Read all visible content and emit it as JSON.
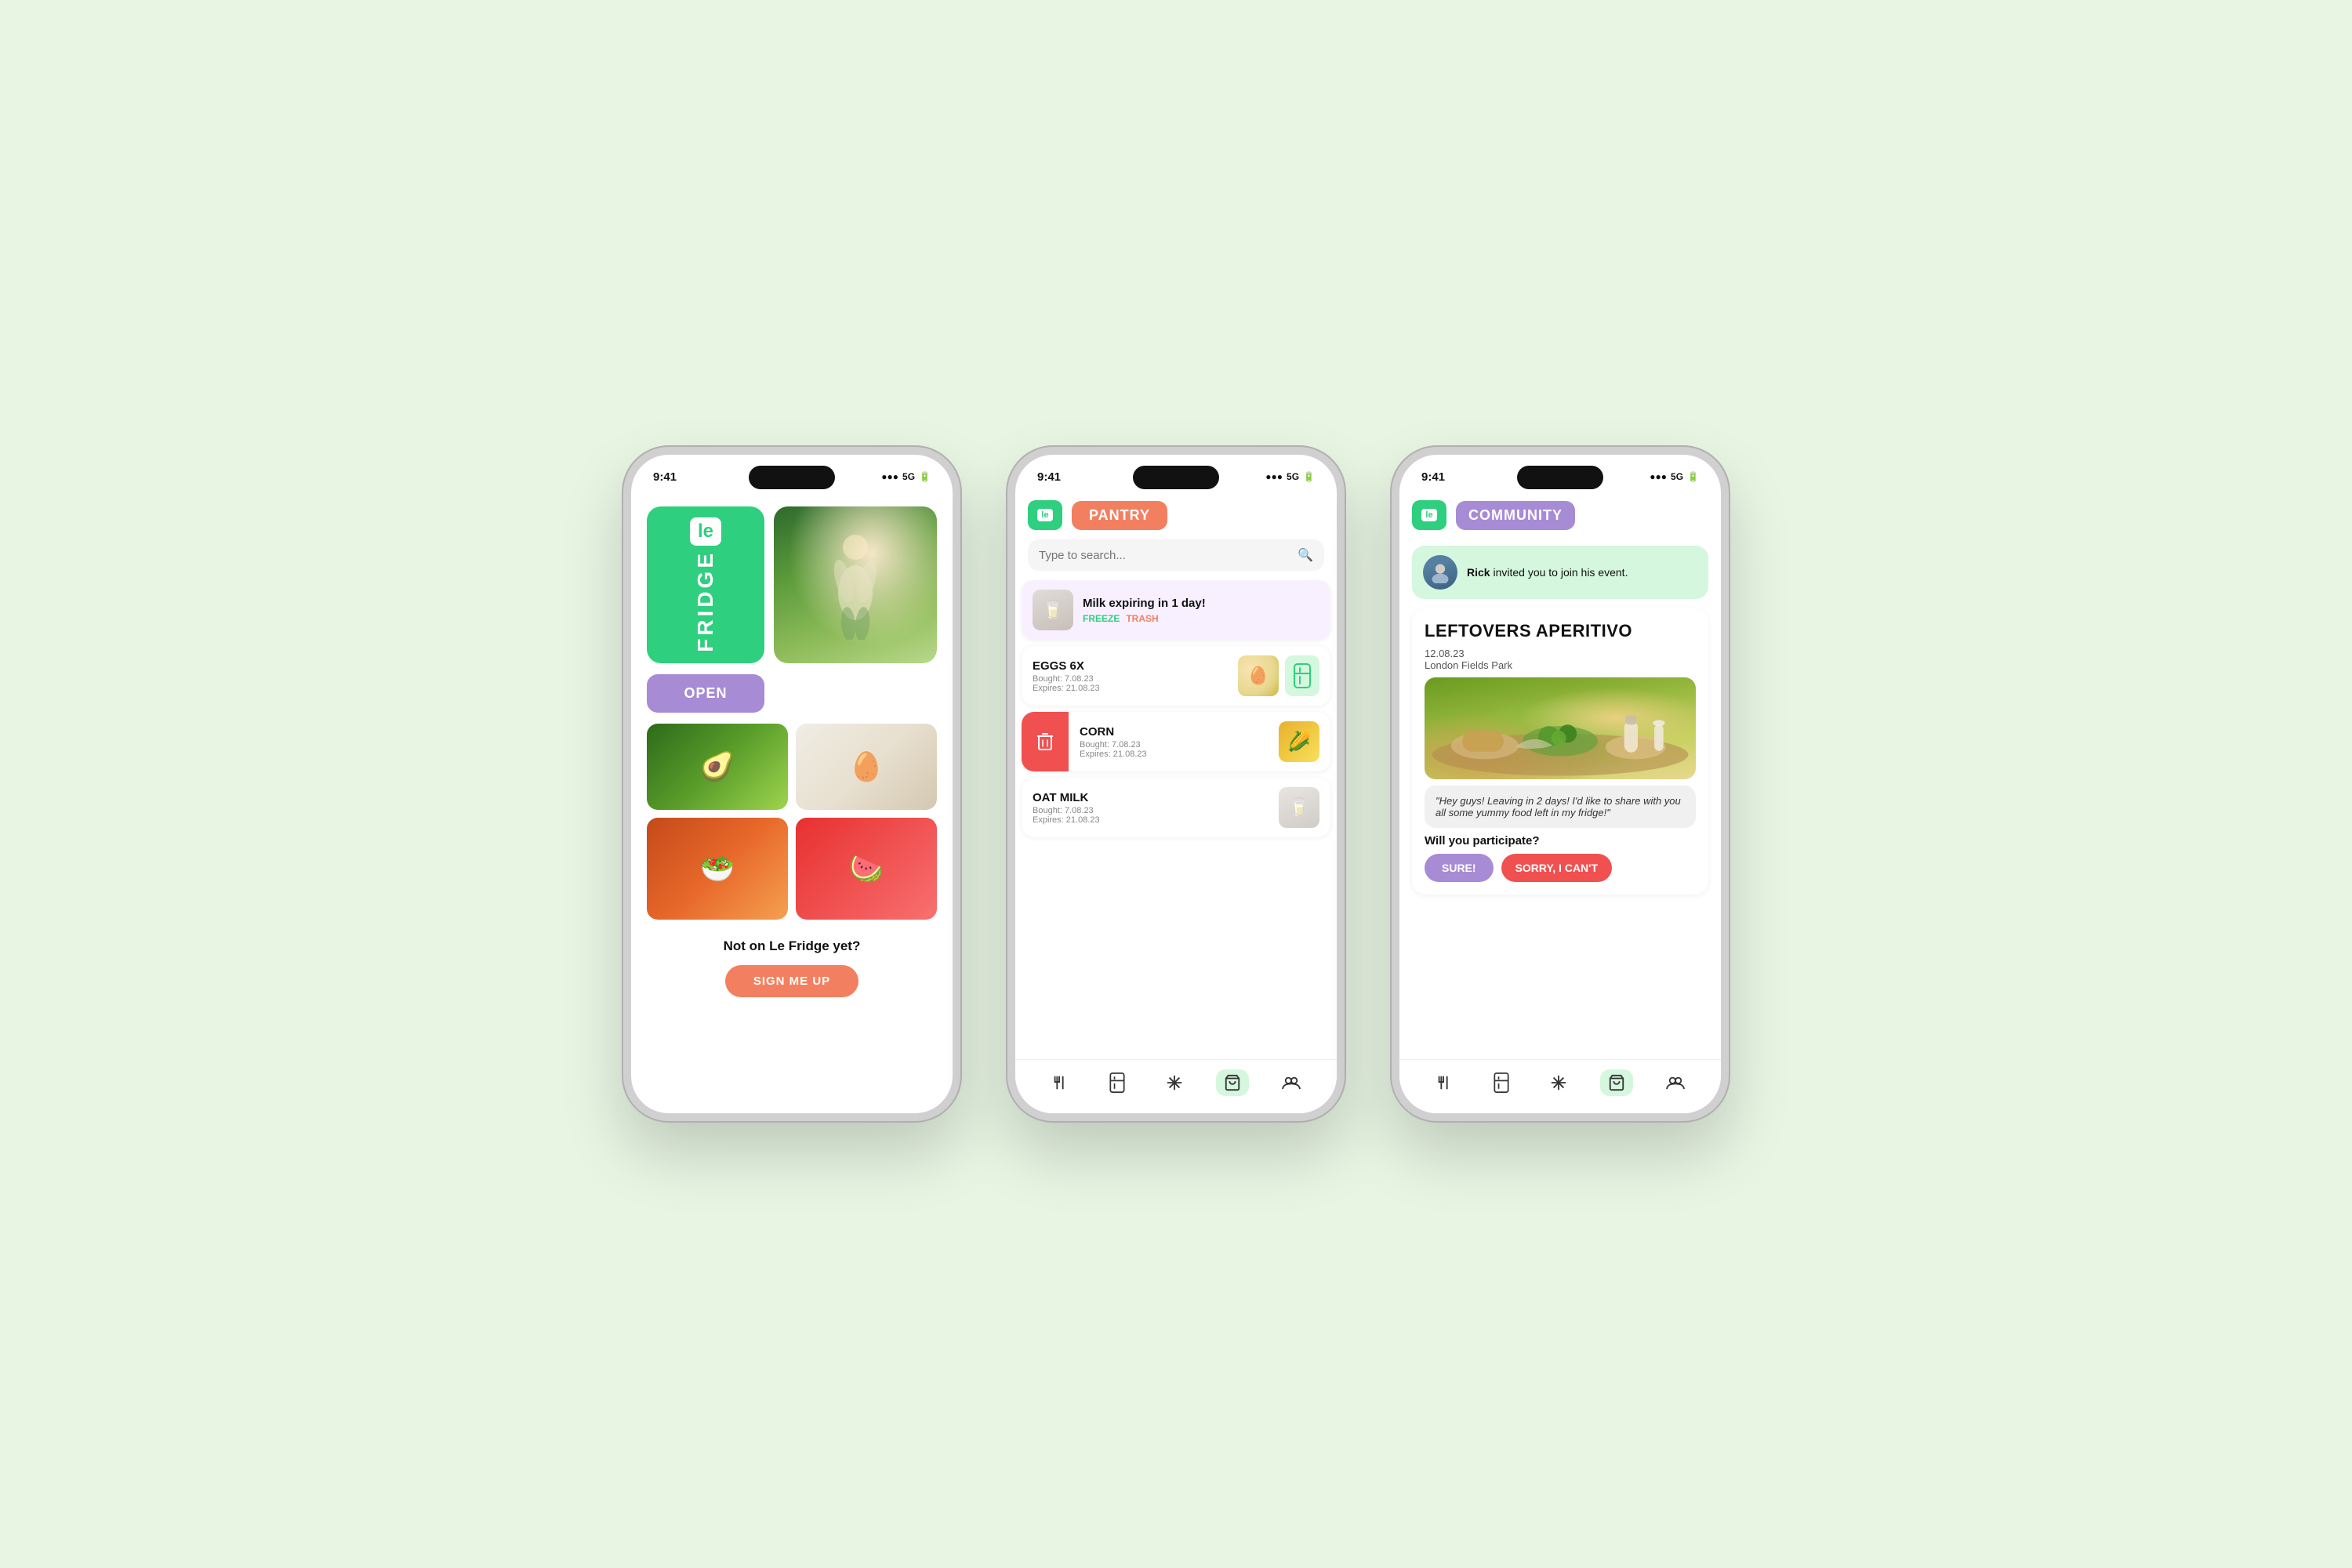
{
  "background": "#e8f5e3",
  "phones": {
    "phone1": {
      "status_bar": {
        "time": "9:41",
        "signal": "●●●",
        "network": "5G",
        "battery": "▌"
      },
      "logo": {
        "le_text": "le",
        "fridge_text": "FRIDGE"
      },
      "open_button": "OPEN",
      "footer": {
        "cta_text": "Not on Le Fridge yet?",
        "sign_up_label": "SIGN ME UP"
      }
    },
    "phone2": {
      "status_bar": {
        "time": "9:41",
        "signal": "●●●",
        "network": "5G",
        "battery": "▌"
      },
      "header": {
        "le_badge": "le",
        "screen_label": "PANTRY"
      },
      "search": {
        "placeholder": "Type to search..."
      },
      "items": [
        {
          "name": "Milk",
          "alert": "expiring in 1 day!",
          "action1": "FREEZE",
          "action2": "TRASH",
          "emoji": "🥛"
        },
        {
          "name": "EGGS 6X",
          "bought": "Bought: 7.08.23",
          "expires": "Expires: 21.08.23",
          "emoji": "🥚"
        },
        {
          "name": "CORN",
          "bought": "Bought: 7.08.23",
          "expires": "Expires: 21.08.23",
          "emoji": "🌽"
        },
        {
          "name": "OAT MILK",
          "bought": "Bought: 7.08.23",
          "expires": "Expires: 21.08.23",
          "emoji": "🥛"
        }
      ],
      "nav": [
        "🍴",
        "📦",
        "❄️",
        "🛒",
        "👥"
      ]
    },
    "phone3": {
      "status_bar": {
        "time": "9:41",
        "signal": "●●●",
        "network": "5G",
        "battery": "▌"
      },
      "header": {
        "le_badge": "le",
        "screen_label": "COMMUNITY"
      },
      "notification": {
        "username": "Rick",
        "message": "invited you to join his event."
      },
      "event": {
        "title": "LEFTOVERS APERITIVO",
        "date": "12.08.23",
        "location": "London Fields Park",
        "quote": "\"Hey guys! Leaving in 2 days! I'd like to share with you all some yummy food left in my fridge!\"",
        "question": "Will you participate?",
        "btn_yes": "SURE!",
        "btn_no": "SORRY, I CAN'T"
      },
      "nav": [
        "🍴",
        "📦",
        "❄️",
        "🛒",
        "👥"
      ]
    }
  }
}
